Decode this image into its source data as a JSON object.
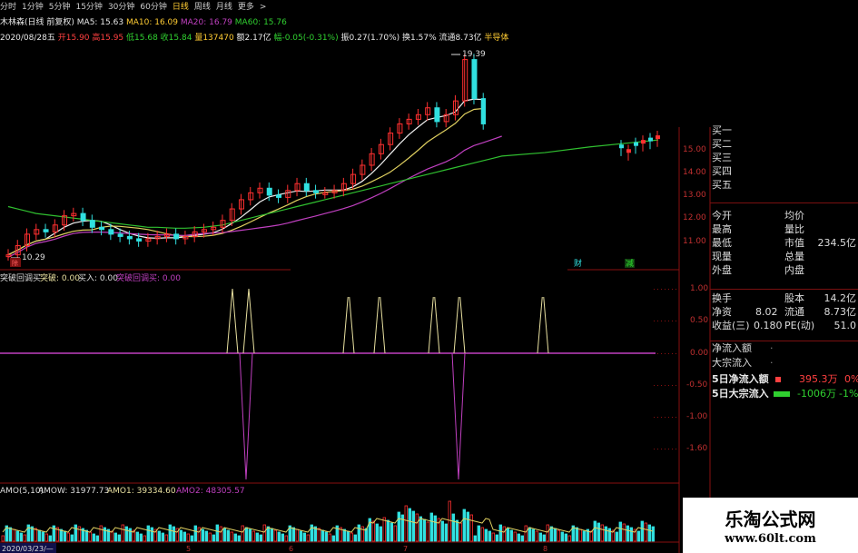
{
  "toolbar": {
    "items": [
      "分时",
      "1分钟",
      "5分钟",
      "15分钟",
      "30分钟",
      "60分钟",
      "日线",
      "周线",
      "月线",
      "更多"
    ],
    "active_index": 6,
    "more_arrow": ">"
  },
  "ma_line": {
    "stock": "木林森(日线 前复权)",
    "ma5": "MA5: 15.63",
    "ma10": "MA10: 16.09",
    "ma20": "MA20: 16.79",
    "ma60": "MA60: 15.76"
  },
  "ohlc_line": {
    "date": "2020/08/28五",
    "open": "开15.90",
    "high": "高15.95",
    "low": "低15.68",
    "close": "收15.84",
    "volume": "量137470",
    "amount": "额2.17亿",
    "change_pct": "幅-0.05(-0.31%)",
    "amplitude": "振0.27(1.70%)",
    "turnover": "换1.57%",
    "float": "流通8.73亿",
    "sector": "半导体"
  },
  "price_panel": {
    "high_label": "19.39",
    "low_label": "10.29",
    "yaxis": [
      "15.00",
      "14.00",
      "13.00",
      "12.00",
      "11.00"
    ],
    "tags": [
      "财",
      "减"
    ]
  },
  "indicator": {
    "title": "突破回调买",
    "s1": "突破: 0.00",
    "s2": "买入: 0.00",
    "s3": "突破回调买: 0.00",
    "yaxis": [
      "1.00",
      "0.50",
      "0.00",
      "-0.50",
      "-1.00",
      "-1.60"
    ]
  },
  "amo": {
    "label": "AMO(5,10)",
    "amow": "AMOW: 31977.73",
    "amo1": "AMO1: 39334.60",
    "amo2": "AMO2: 48305.57",
    "date_label": "2020/03/23/—"
  },
  "xaxis": [
    "5",
    "6",
    "7",
    "8"
  ],
  "quote": {
    "buy": [
      "买一",
      "买二",
      "买三",
      "买四",
      "买五"
    ],
    "rows": [
      {
        "l1": "今开",
        "v1": "",
        "l2": "均价",
        "v2": ""
      },
      {
        "l1": "最高",
        "v1": "",
        "l2": "量比",
        "v2": ""
      },
      {
        "l1": "最低",
        "v1": "",
        "l2": "市值",
        "v2": "234.5亿"
      },
      {
        "l1": "现量",
        "v1": "",
        "l2": "总量",
        "v2": ""
      },
      {
        "l1": "外盘",
        "v1": "",
        "l2": "内盘",
        "v2": ""
      }
    ],
    "rows2": [
      {
        "l1": "换手",
        "v1": "",
        "l2": "股本",
        "v2": "14.2亿"
      },
      {
        "l1": "净资",
        "v1": "8.02",
        "l2": "流通",
        "v2": "8.73亿"
      },
      {
        "l1": "收益(三)",
        "v1": "0.180",
        "l2": "PE(动)",
        "v2": "51.0"
      }
    ],
    "flow": [
      {
        "label": "净流入额",
        "value": "",
        "pct": ""
      },
      {
        "label": "大宗流入",
        "value": "",
        "pct": ""
      },
      {
        "label": "5日净流入额",
        "value": "395.3万",
        "pct": "0%"
      },
      {
        "label": "5日大宗流入",
        "value": "-1006万",
        "pct": "-1%"
      }
    ]
  },
  "watermark": {
    "title": "乐淘公式网",
    "url": "www.60lt.com"
  },
  "colors": {
    "up": "#ff3030",
    "down": "#30e0e0",
    "ma5": "#f0f0f0",
    "ma10": "#e0d060",
    "ma20": "#c040c0",
    "ma60": "#30c030",
    "signal_buy": "#e8e0a0",
    "signal_line": "#c040c0"
  }
}
